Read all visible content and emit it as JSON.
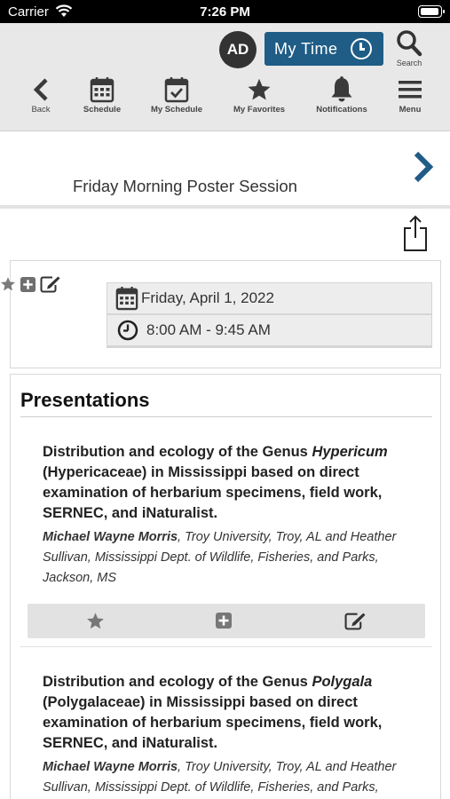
{
  "status_bar": {
    "carrier": "Carrier",
    "time": "7:26 PM"
  },
  "header": {
    "avatar_initials": "AD",
    "my_time_label": "My Time",
    "search_label": "Search",
    "nav": [
      {
        "label": "Back",
        "icon": "back-arrow-icon"
      },
      {
        "label": "Schedule",
        "icon": "calendar-icon"
      },
      {
        "label": "My Schedule",
        "icon": "calendar-check-icon"
      },
      {
        "label": "My Favorites",
        "icon": "star-icon"
      },
      {
        "label": "Notifications",
        "icon": "bell-icon"
      },
      {
        "label": "Menu",
        "icon": "hamburger-icon"
      }
    ]
  },
  "session": {
    "title": "Friday Morning Poster Session",
    "date": "Friday, April 1, 2022",
    "time": "8:00 AM - 9:45 AM"
  },
  "presentations": {
    "heading": "Presentations",
    "items": [
      {
        "title_pre": "Distribution and ecology of the Genus ",
        "title_genus": "Hypericum",
        "title_post": " (Hypericaceae) in Mississippi based on direct examination of herbarium specimens, field work, SERNEC, and iNaturalist.",
        "lead_author": "Michael Wayne Morris",
        "authors_rest": ", Troy University, Troy, AL and Heather Sullivan, Mississippi Dept. of Wildlife, Fisheries, and Parks, Jackson, MS"
      },
      {
        "title_pre": "Distribution and ecology of the Genus ",
        "title_genus": "Polygala",
        "title_post": " (Polygalaceae) in Mississippi based on direct examination of herbarium specimens, field work, SERNEC, and iNaturalist.",
        "lead_author": "Michael Wayne Morris",
        "authors_rest": ", Troy University, Troy, AL and Heather Sullivan, Mississippi Dept. of Wildlife, Fisheries, and Parks,"
      }
    ]
  },
  "colors": {
    "accent": "#1f5c86",
    "header_bg": "#e8e8e8",
    "icon": "#3a3a3a"
  }
}
